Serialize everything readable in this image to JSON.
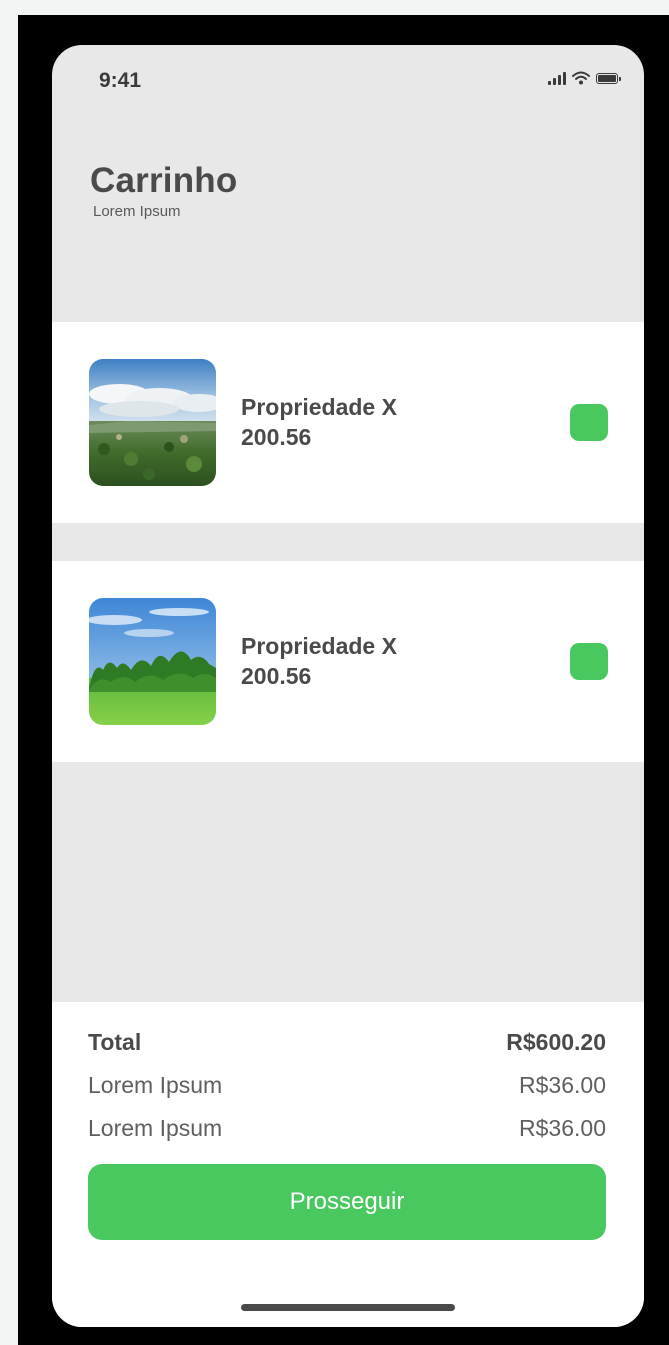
{
  "status_bar": {
    "time": "9:41",
    "icons": [
      "signal-icon",
      "wifi-icon",
      "battery-icon"
    ]
  },
  "header": {
    "title": "Carrinho",
    "subtitle": "Lorem Ipsum"
  },
  "cart": {
    "items": [
      {
        "name": "Propriedade X",
        "price": "200.56",
        "image": "landscape-hills-photo",
        "selected": true
      },
      {
        "name": "Propriedade X",
        "price": "200.56",
        "image": "landscape-trees-field-photo",
        "selected": true
      }
    ]
  },
  "summary": {
    "total_label": "Total",
    "total_value": "R$600.20",
    "lines": [
      {
        "label": "Lorem Ipsum",
        "value": "R$36.00"
      },
      {
        "label": "Lorem Ipsum",
        "value": "R$36.00"
      }
    ],
    "proceed_label": "Prosseguir"
  },
  "colors": {
    "accent": "#4ac860",
    "background": "#e8e8e8",
    "text": "#4a4a4a"
  }
}
